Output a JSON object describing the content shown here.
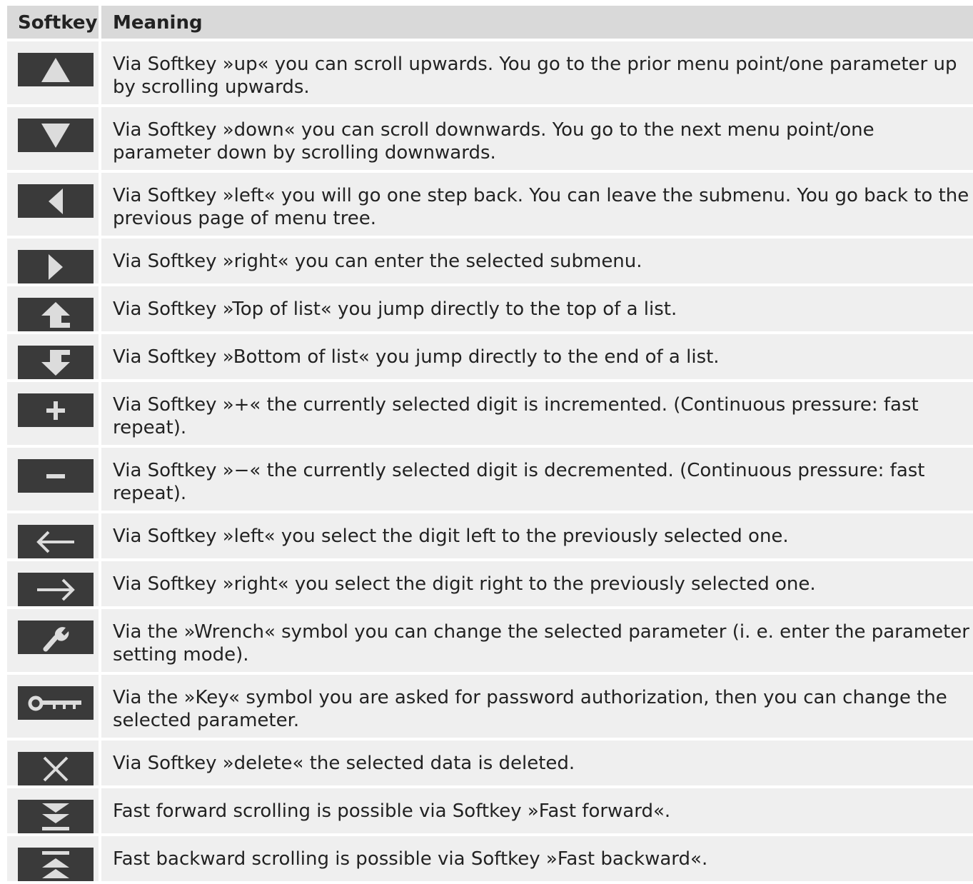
{
  "header": {
    "col_softkey": "Softkey",
    "col_meaning": "Meaning"
  },
  "rows": [
    {
      "icon": "up-triangle-icon",
      "meaning": "Via Softkey »up« you can scroll upwards. You go to the prior menu point/one parameter up by scrolling upwards."
    },
    {
      "icon": "down-triangle-icon",
      "meaning": "Via Softkey »down« you can scroll downwards. You go to the next menu point/one parameter down by scrolling downwards."
    },
    {
      "icon": "left-triangle-icon",
      "meaning": "Via Softkey »left« you will go one step back. You can leave the submenu. You go back to the previous page of menu tree."
    },
    {
      "icon": "right-triangle-icon",
      "meaning": "Via Softkey »right« you can enter the selected submenu."
    },
    {
      "icon": "top-of-list-icon",
      "meaning": "Via Softkey »Top of list« you jump directly to the top of a list."
    },
    {
      "icon": "bottom-of-list-icon",
      "meaning": "Via Softkey »Bottom of list« you jump directly to the end of a list."
    },
    {
      "icon": "plus-icon",
      "meaning": "Via Softkey »+« the currently selected digit is incremented. (Continuous pressure: fast repeat)."
    },
    {
      "icon": "minus-icon",
      "meaning": "Via Softkey »−« the currently selected digit is decremented. (Continuous pressure: fast repeat)."
    },
    {
      "icon": "arrow-left-icon",
      "meaning": "Via Softkey »left« you select the digit left to the previously selected one."
    },
    {
      "icon": "arrow-right-icon",
      "meaning": "Via Softkey »right« you select the digit right to the previously selected one."
    },
    {
      "icon": "wrench-icon",
      "meaning": "Via the »Wrench« symbol you can change the selected parameter (i. e. enter the parameter setting mode)."
    },
    {
      "icon": "key-icon",
      "meaning": "Via the »Key« symbol you are asked for password authorization, then you can change the selected parameter."
    },
    {
      "icon": "delete-x-icon",
      "meaning": "Via Softkey »delete« the selected data is deleted."
    },
    {
      "icon": "fast-forward-icon",
      "meaning": "Fast forward scrolling is possible via Softkey »Fast forward«."
    },
    {
      "icon": "fast-backward-icon",
      "meaning": "Fast backward scrolling is possible via Softkey »Fast backward«."
    }
  ]
}
